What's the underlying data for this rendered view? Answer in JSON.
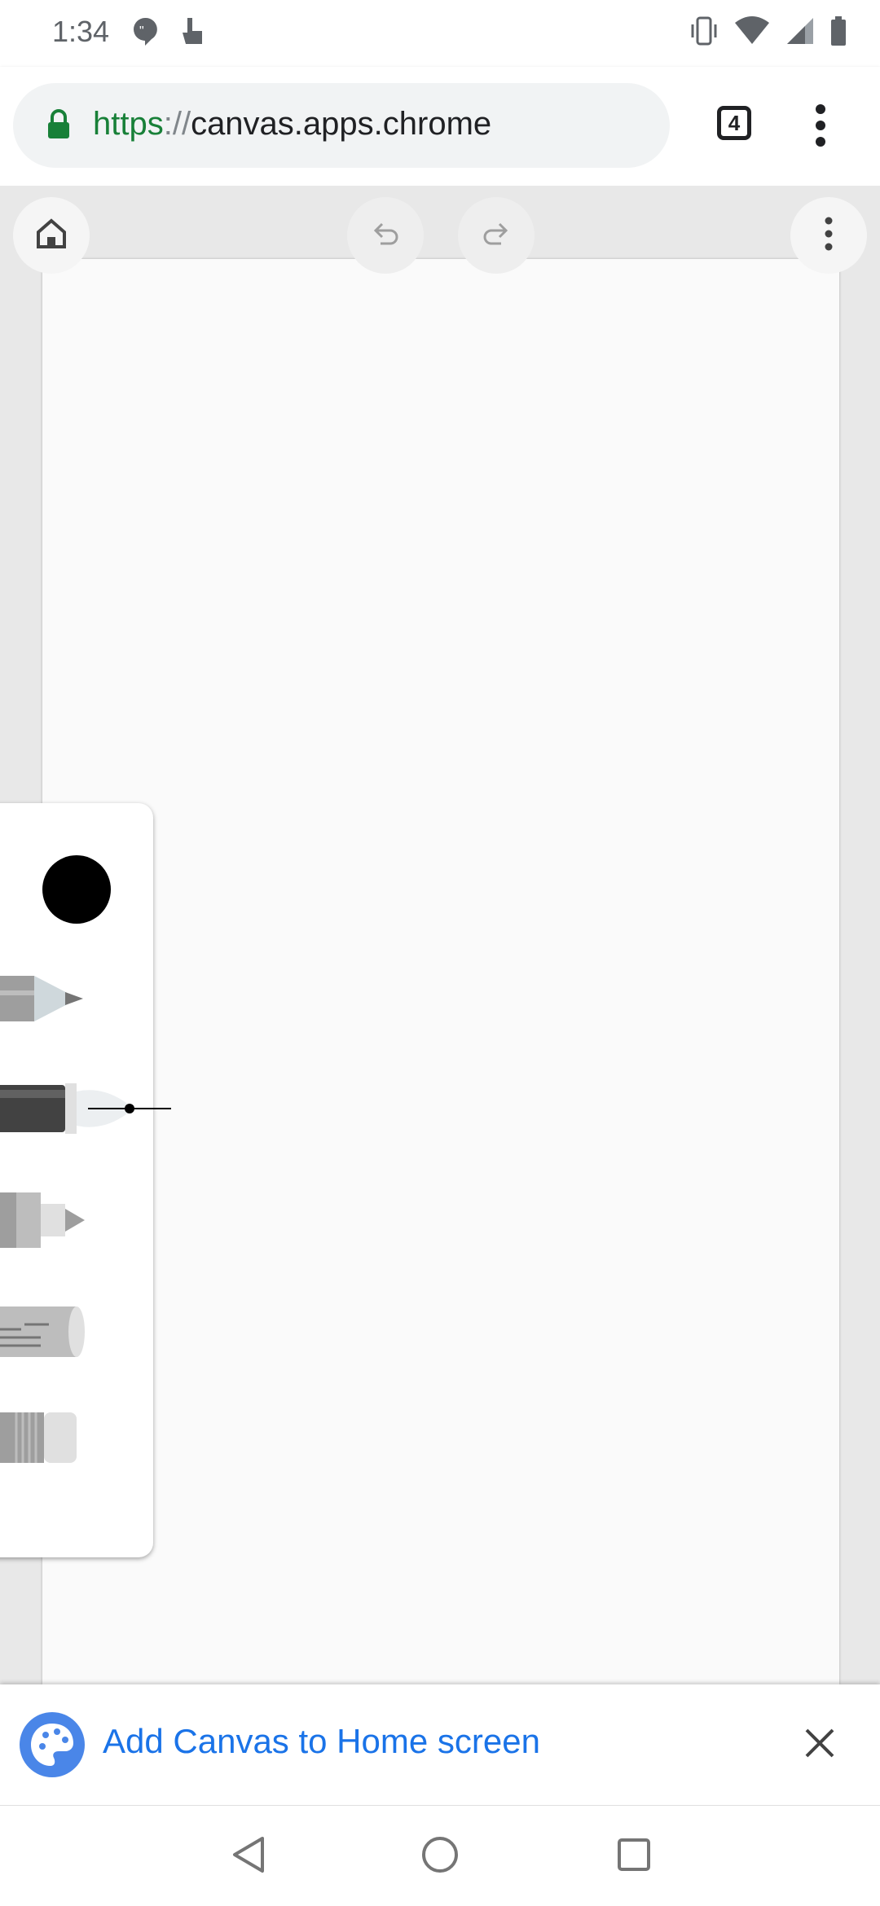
{
  "status_bar": {
    "time": "1:34",
    "left_icons": [
      "quote-notification-icon",
      "touch-notification-icon"
    ],
    "right_icons": [
      "vibrate-icon",
      "wifi-icon",
      "signal-icon",
      "battery-icon"
    ]
  },
  "browser": {
    "url_scheme": "https",
    "url_separator": "://",
    "url_host": "canvas.apps.chrome",
    "tab_count": "4",
    "icons": [
      "lock-icon",
      "tab-switcher-icon",
      "more-vert-icon"
    ]
  },
  "canvas_toolbar": {
    "icons": [
      "home-icon",
      "undo-icon",
      "redo-icon",
      "more-vert-icon"
    ]
  },
  "tool_panel": {
    "selected_color": "#000000",
    "tools": [
      "pencil",
      "pen",
      "marker",
      "chalk",
      "eraser"
    ],
    "selected_tool": "pen"
  },
  "install_banner": {
    "text": "Add Canvas to Home screen",
    "icons": [
      "canvas-palette-icon",
      "close-icon"
    ],
    "accent": "#1a73e8"
  },
  "nav_bar": {
    "icons": [
      "back-icon",
      "home-circle-icon",
      "recents-icon"
    ]
  }
}
